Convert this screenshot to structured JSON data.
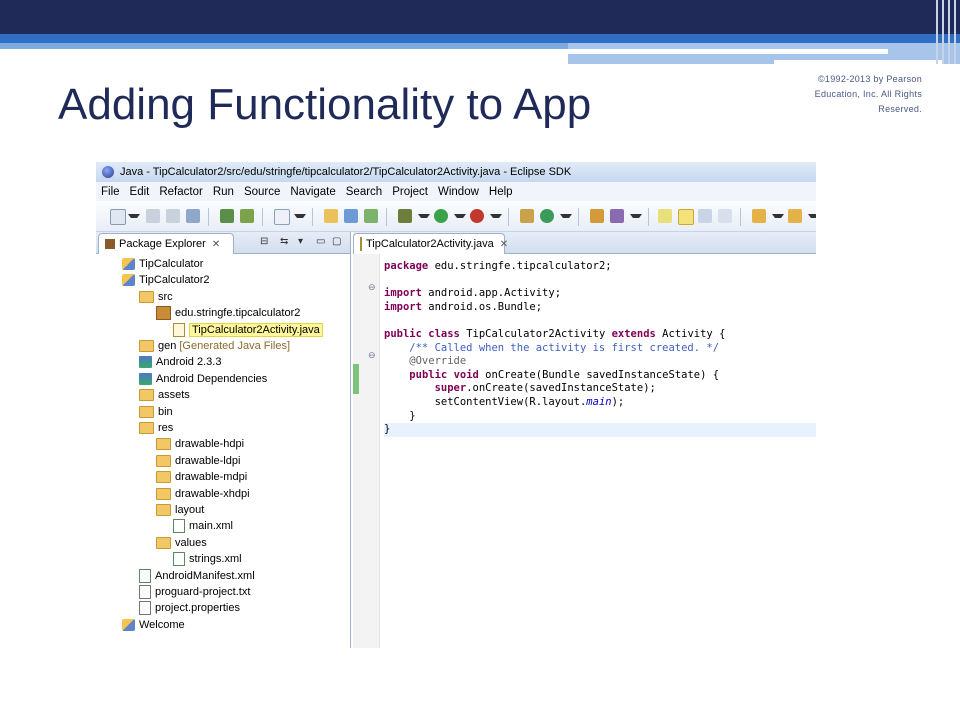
{
  "slide": {
    "title": "Adding Functionality to App",
    "copyright_lines": [
      "©1992-2013 by Pearson",
      "Education, Inc. All Rights",
      "Reserved."
    ]
  },
  "window": {
    "title": "Java - TipCalculator2/src/edu/stringfe/tipcalculator2/TipCalculator2Activity.java - Eclipse SDK"
  },
  "menu": [
    "File",
    "Edit",
    "Refactor",
    "Run",
    "Source",
    "Navigate",
    "Search",
    "Project",
    "Window",
    "Help"
  ],
  "package_explorer": {
    "tab_label": "Package Explorer",
    "tree": [
      {
        "label": "TipCalculator",
        "icon": "project-icon",
        "depth": 0
      },
      {
        "label": "TipCalculator2",
        "icon": "project-icon",
        "depth": 0
      },
      {
        "label": "src",
        "icon": "source-folder-icon",
        "depth": 1
      },
      {
        "label": "edu.stringfe.tipcalculator2",
        "icon": "package-icon",
        "depth": 2
      },
      {
        "label": "TipCalculator2Activity.java",
        "icon": "java-file-icon",
        "depth": 3,
        "highlighted": true
      },
      {
        "label": "gen",
        "extra": "[Generated Java Files]",
        "icon": "source-folder-icon",
        "depth": 1
      },
      {
        "label": "Android 2.3.3",
        "icon": "library-icon",
        "depth": 1
      },
      {
        "label": "Android Dependencies",
        "icon": "library-icon",
        "depth": 1
      },
      {
        "label": "assets",
        "icon": "folder-icon",
        "depth": 1
      },
      {
        "label": "bin",
        "icon": "folder-icon",
        "depth": 1
      },
      {
        "label": "res",
        "icon": "folder-icon",
        "depth": 1
      },
      {
        "label": "drawable-hdpi",
        "icon": "folder-icon",
        "depth": 2
      },
      {
        "label": "drawable-ldpi",
        "icon": "folder-icon",
        "depth": 2
      },
      {
        "label": "drawable-mdpi",
        "icon": "folder-icon",
        "depth": 2
      },
      {
        "label": "drawable-xhdpi",
        "icon": "folder-icon",
        "depth": 2
      },
      {
        "label": "layout",
        "icon": "folder-icon",
        "depth": 2
      },
      {
        "label": "main.xml",
        "icon": "xml-file-icon",
        "depth": 3
      },
      {
        "label": "values",
        "icon": "folder-icon",
        "depth": 2
      },
      {
        "label": "strings.xml",
        "icon": "xml-file-icon",
        "depth": 3
      },
      {
        "label": "AndroidManifest.xml",
        "icon": "xml-file-icon",
        "depth": 1
      },
      {
        "label": "proguard-project.txt",
        "icon": "text-file-icon",
        "depth": 1
      },
      {
        "label": "project.properties",
        "icon": "text-file-icon",
        "depth": 1
      },
      {
        "label": "Welcome",
        "icon": "project-icon",
        "depth": 0
      }
    ]
  },
  "editor": {
    "tab_label": "TipCalculator2Activity.java",
    "lines": [
      [
        {
          "t": "package",
          "k": "kw"
        },
        {
          "t": " edu.stringfe.tipcalculator2;"
        }
      ],
      [],
      [
        {
          "t": "import",
          "k": "kw"
        },
        {
          "t": " android.app.Activity;"
        }
      ],
      [
        {
          "t": "import",
          "k": "kw"
        },
        {
          "t": " android.os.Bundle;"
        }
      ],
      [],
      [
        {
          "t": "public",
          "k": "kw"
        },
        {
          "t": " "
        },
        {
          "t": "class",
          "k": "kw"
        },
        {
          "t": " TipCalculator2Activity "
        },
        {
          "t": "extends",
          "k": "kw"
        },
        {
          "t": " Activity {"
        }
      ],
      [
        {
          "t": "    /** Called when the activity is first created. */",
          "k": "cm"
        }
      ],
      [
        {
          "t": "    @Override",
          "k": "an"
        }
      ],
      [
        {
          "t": "    "
        },
        {
          "t": "public",
          "k": "kw"
        },
        {
          "t": " "
        },
        {
          "t": "void",
          "k": "kw"
        },
        {
          "t": " onCreate(Bundle savedInstanceState) {"
        }
      ],
      [
        {
          "t": "        "
        },
        {
          "t": "super",
          "k": "kw"
        },
        {
          "t": ".onCreate(savedInstanceState);"
        }
      ],
      [
        {
          "t": "        setContentView(R.layout."
        },
        {
          "t": "main",
          "k": "fi"
        },
        {
          "t": ");"
        }
      ],
      [
        {
          "t": "    }"
        }
      ],
      [
        {
          "t": "}"
        }
      ]
    ]
  }
}
